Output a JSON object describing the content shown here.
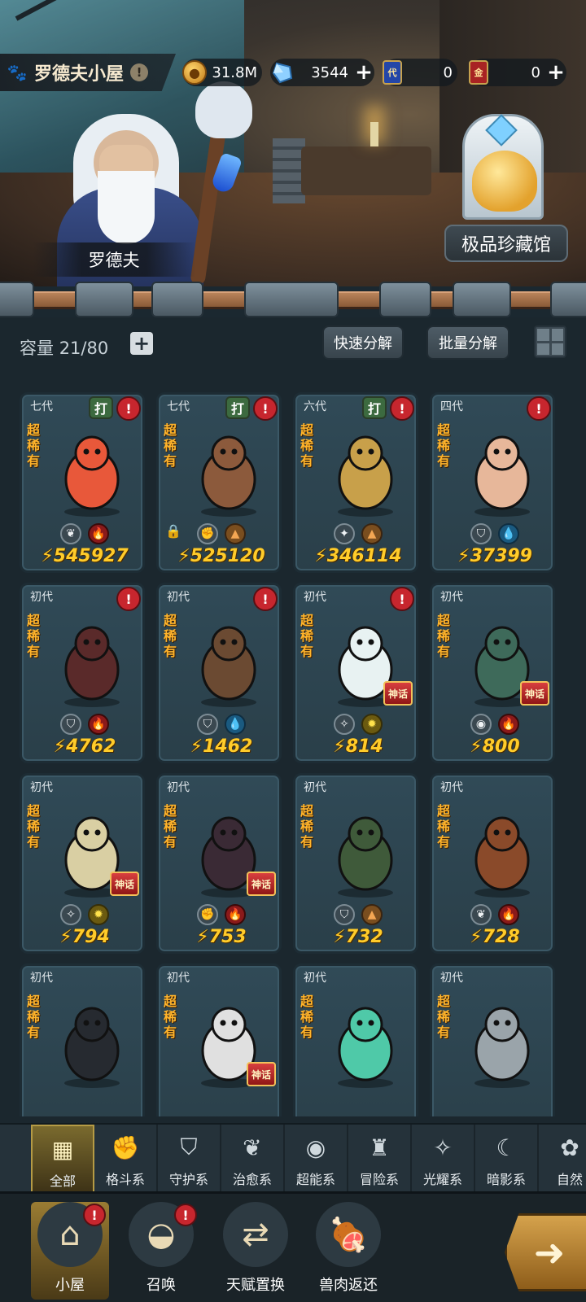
{
  "header": {
    "title": "罗德夫小屋",
    "info": "!",
    "resources": [
      {
        "name": "gold",
        "icon": "gold-coin-icon",
        "value": "31.8M",
        "has_plus": false
      },
      {
        "name": "crystal",
        "icon": "blue-crystal-icon",
        "value": "3544",
        "has_plus": true
      },
      {
        "name": "card-blue",
        "icon": "blue-card-icon",
        "badge": "代",
        "value": "0",
        "has_plus": false
      },
      {
        "name": "card-red",
        "icon": "red-card-icon",
        "badge": "金",
        "value": "0",
        "has_plus": true
      }
    ]
  },
  "scene": {
    "npc_name": "罗德夫",
    "museum_label": "极品珍藏馆"
  },
  "inventory": {
    "capacity_label": "容量",
    "capacity_value": "21/80",
    "quick_decompose": "快速分解",
    "batch_decompose": "批量分解",
    "cards": [
      {
        "gen": "七代",
        "rarity": "超稀有",
        "power": "545927",
        "da": true,
        "alert": true,
        "locked": false,
        "myth": false,
        "types": [
          "leaf-icon",
          "fire-icon"
        ],
        "type_styles": [
          "light",
          "red"
        ],
        "type_glyphs": [
          "❦",
          "🔥"
        ],
        "color": "#e8583a"
      },
      {
        "gen": "七代",
        "rarity": "超稀有",
        "power": "525120",
        "da": true,
        "alert": true,
        "locked": true,
        "myth": false,
        "types": [
          "fist-icon",
          "earth-icon"
        ],
        "type_styles": [
          "light",
          "earth"
        ],
        "type_glyphs": [
          "✊",
          "▲"
        ],
        "color": "#8c5a3c"
      },
      {
        "gen": "六代",
        "rarity": "超稀有",
        "power": "346114",
        "da": true,
        "alert": true,
        "locked": false,
        "myth": false,
        "types": [
          "wind-icon",
          "earth-icon"
        ],
        "type_styles": [
          "light",
          "earth"
        ],
        "type_glyphs": [
          "✦",
          "▲"
        ],
        "color": "#c8a04a"
      },
      {
        "gen": "四代",
        "rarity": "超稀有",
        "power": "37399",
        "da": false,
        "alert": true,
        "locked": false,
        "myth": false,
        "types": [
          "shield-icon",
          "water-icon"
        ],
        "type_styles": [
          "light",
          "water"
        ],
        "type_glyphs": [
          "⛉",
          "💧"
        ],
        "color": "#e7b79a"
      },
      {
        "gen": "初代",
        "rarity": "超稀有",
        "power": "4762",
        "da": false,
        "alert": true,
        "locked": false,
        "myth": false,
        "types": [
          "shield-icon",
          "fire-icon"
        ],
        "type_styles": [
          "light",
          "red"
        ],
        "type_glyphs": [
          "⛉",
          "🔥"
        ],
        "color": "#5a2a2a"
      },
      {
        "gen": "初代",
        "rarity": "超稀有",
        "power": "1462",
        "da": false,
        "alert": true,
        "locked": false,
        "myth": false,
        "types": [
          "shield-icon",
          "water-icon"
        ],
        "type_styles": [
          "light",
          "water"
        ],
        "type_glyphs": [
          "⛉",
          "💧"
        ],
        "color": "#6b4a32"
      },
      {
        "gen": "初代",
        "rarity": "超稀有",
        "power": "814",
        "da": false,
        "alert": true,
        "locked": false,
        "myth": true,
        "types": [
          "light-icon",
          "star-icon"
        ],
        "type_styles": [
          "light",
          "star"
        ],
        "type_glyphs": [
          "✧",
          "✹"
        ],
        "color": "#e8f2f2"
      },
      {
        "gen": "初代",
        "rarity": "超稀有",
        "power": "800",
        "da": false,
        "alert": false,
        "locked": false,
        "myth": true,
        "types": [
          "psychic-icon",
          "fire-icon"
        ],
        "type_styles": [
          "light",
          "red"
        ],
        "type_glyphs": [
          "◉",
          "🔥"
        ],
        "color": "#3e6a5a"
      },
      {
        "gen": "初代",
        "rarity": "超稀有",
        "power": "794",
        "da": false,
        "alert": false,
        "locked": false,
        "myth": true,
        "types": [
          "light-icon",
          "star-icon"
        ],
        "type_styles": [
          "light",
          "star"
        ],
        "type_glyphs": [
          "✧",
          "✹"
        ],
        "color": "#d9cfa3"
      },
      {
        "gen": "初代",
        "rarity": "超稀有",
        "power": "753",
        "da": false,
        "alert": false,
        "locked": false,
        "myth": true,
        "types": [
          "fist-icon",
          "fire-icon"
        ],
        "type_styles": [
          "light",
          "red"
        ],
        "type_glyphs": [
          "✊",
          "🔥"
        ],
        "color": "#3a2a35"
      },
      {
        "gen": "初代",
        "rarity": "超稀有",
        "power": "732",
        "da": false,
        "alert": false,
        "locked": false,
        "myth": false,
        "types": [
          "shield-icon",
          "earth-icon"
        ],
        "type_styles": [
          "light",
          "earth"
        ],
        "type_glyphs": [
          "⛉",
          "▲"
        ],
        "color": "#3f5a3a"
      },
      {
        "gen": "初代",
        "rarity": "超稀有",
        "power": "728",
        "da": false,
        "alert": false,
        "locked": false,
        "myth": false,
        "types": [
          "leaf-icon",
          "fire-icon"
        ],
        "type_styles": [
          "light",
          "red"
        ],
        "type_glyphs": [
          "❦",
          "🔥"
        ],
        "color": "#8a4a2a"
      },
      {
        "gen": "初代",
        "rarity": "超稀有",
        "power": "",
        "da": false,
        "alert": false,
        "locked": false,
        "myth": false,
        "types": [],
        "type_styles": [],
        "type_glyphs": [],
        "color": "#262a30"
      },
      {
        "gen": "初代",
        "rarity": "超稀有",
        "power": "",
        "da": false,
        "alert": false,
        "locked": false,
        "myth": true,
        "types": [],
        "type_styles": [],
        "type_glyphs": [],
        "color": "#e0e0e0"
      },
      {
        "gen": "初代",
        "rarity": "超稀有",
        "power": "",
        "da": false,
        "alert": false,
        "locked": false,
        "myth": false,
        "types": [],
        "type_styles": [],
        "type_glyphs": [],
        "color": "#4fc9a8"
      },
      {
        "gen": "初代",
        "rarity": "超稀有",
        "power": "",
        "da": false,
        "alert": false,
        "locked": false,
        "myth": false,
        "types": [],
        "type_styles": [],
        "type_glyphs": [],
        "color": "#9aa4aa"
      }
    ],
    "da_label": "打",
    "myth_label": "神话",
    "alert_label": "!"
  },
  "filters": [
    {
      "label": "全部",
      "icon": "all-grid-icon",
      "glyph": "▦",
      "active": true
    },
    {
      "label": "格斗系",
      "icon": "fist-icon",
      "glyph": "✊",
      "active": false
    },
    {
      "label": "守护系",
      "icon": "shield-icon",
      "glyph": "⛉",
      "active": false
    },
    {
      "label": "治愈系",
      "icon": "leaf-icon",
      "glyph": "❦",
      "active": false
    },
    {
      "label": "超能系",
      "icon": "psychic-icon",
      "glyph": "◉",
      "active": false
    },
    {
      "label": "冒险系",
      "icon": "lantern-icon",
      "glyph": "♜",
      "active": false
    },
    {
      "label": "光耀系",
      "icon": "light-icon",
      "glyph": "✧",
      "active": false
    },
    {
      "label": "暗影系",
      "icon": "moon-icon",
      "glyph": "☾",
      "active": false
    },
    {
      "label": "自然",
      "icon": "nature-icon",
      "glyph": "✿",
      "active": false
    }
  ],
  "bottom_nav": [
    {
      "label": "小屋",
      "icon": "house-icon",
      "glyph": "⌂",
      "active": true,
      "dot": "!"
    },
    {
      "label": "召唤",
      "icon": "egg-icon",
      "glyph": "◒",
      "active": false,
      "dot": "!"
    },
    {
      "label": "天赋置换",
      "icon": "swap-icon",
      "glyph": "⇄",
      "active": false,
      "dot": ""
    },
    {
      "label": "兽肉返还",
      "icon": "meat-icon",
      "glyph": "🍖",
      "active": false,
      "dot": ""
    }
  ],
  "go_icon": "arrow-right-icon"
}
